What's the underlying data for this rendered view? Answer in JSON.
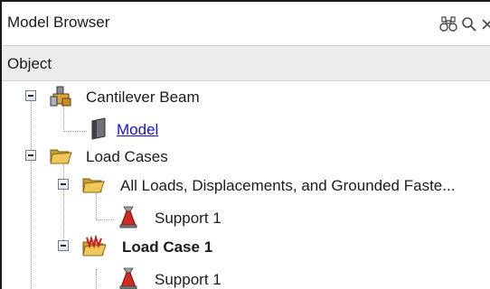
{
  "panel": {
    "title": "Model Browser",
    "icons": [
      "binoculars-icon",
      "search-icon",
      "close-icon"
    ]
  },
  "columns": {
    "object_header": "Object"
  },
  "tree": {
    "cantilever_beam": {
      "label": "Cantilever Beam",
      "icon": "beam-assembly-icon",
      "expanded": true
    },
    "model": {
      "label": "Model",
      "icon": "model-part-icon",
      "style": "link"
    },
    "load_cases": {
      "label": "Load Cases",
      "icon": "folder-icon",
      "expanded": true
    },
    "all_loads": {
      "label": "All Loads, Displacements, and Grounded Faste...",
      "icon": "folder-icon",
      "expanded": true
    },
    "support_1a": {
      "label": "Support 1",
      "icon": "support-icon"
    },
    "load_case_1": {
      "label": "Load Case 1",
      "icon": "load-case-icon",
      "expanded": true,
      "style": "bold"
    },
    "support_1b": {
      "label": "Support 1",
      "icon": "support-icon"
    }
  },
  "colors": {
    "link": "#1a12d8",
    "header_bg": "#ececec",
    "folder": "#e6b94a",
    "support_red": "#c62020"
  }
}
